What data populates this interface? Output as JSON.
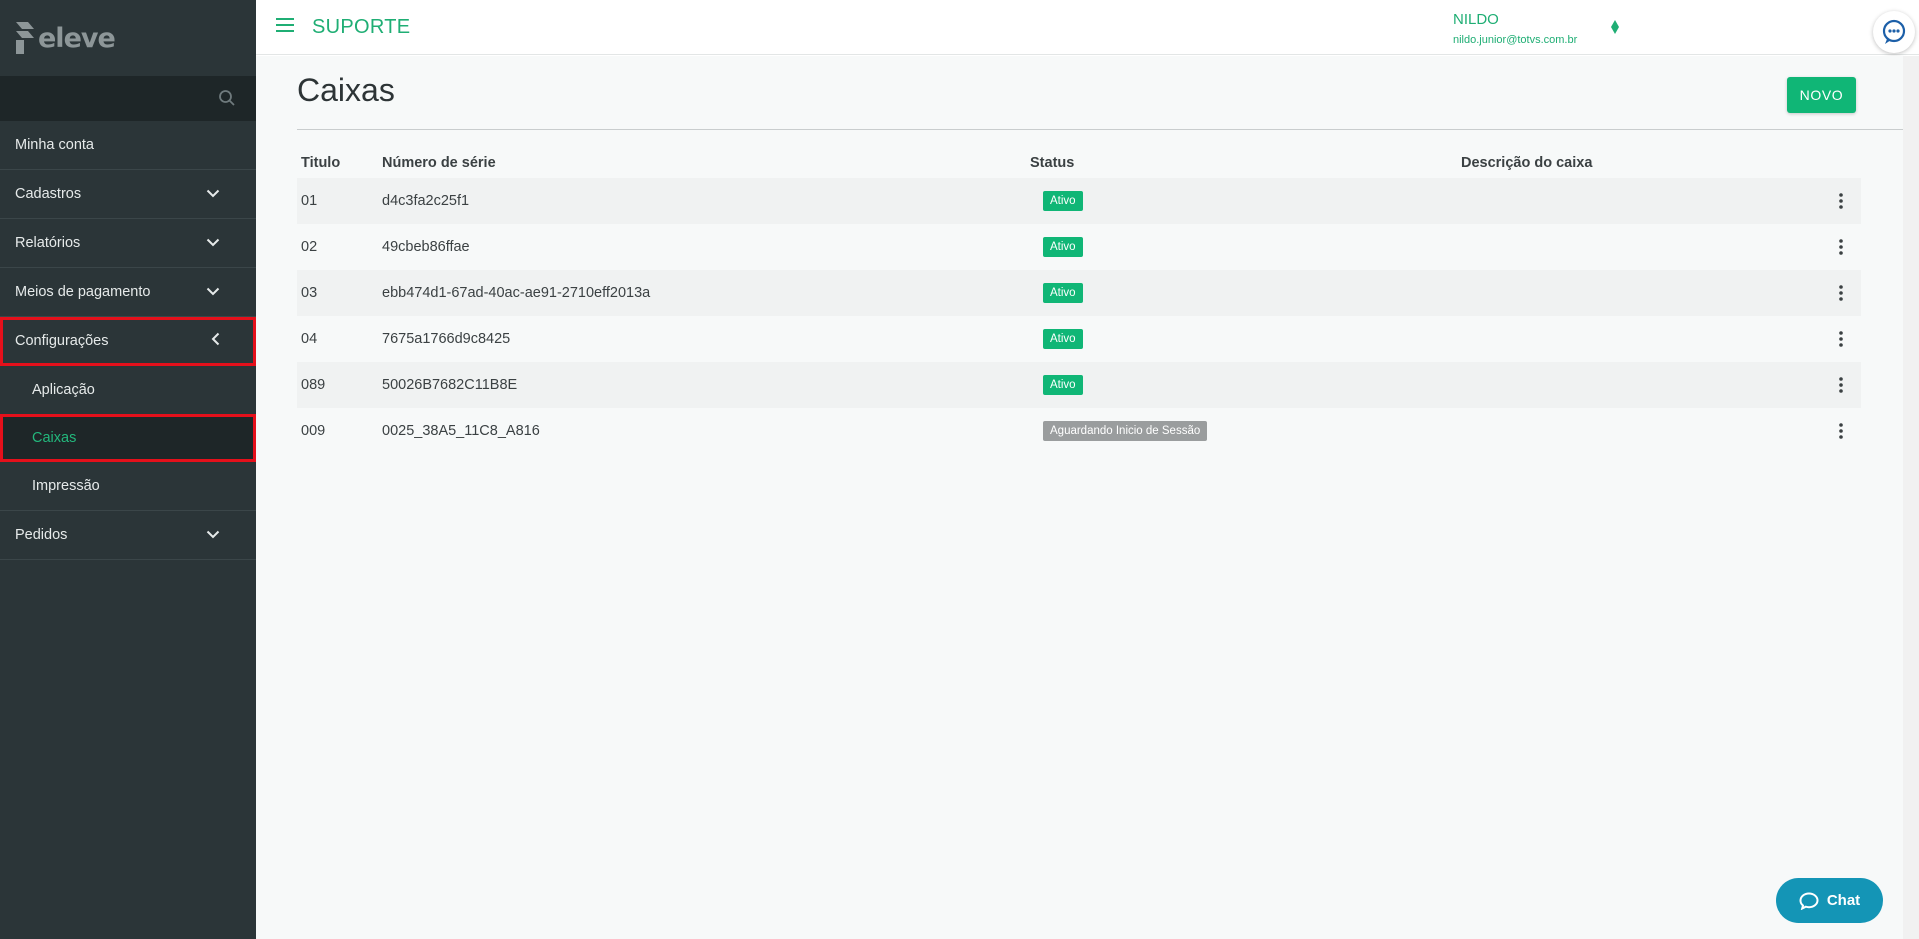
{
  "sidebar": {
    "logo_text": "eleve",
    "search_icon": "search-icon",
    "items": [
      {
        "label": "Minha conta",
        "icon": null
      },
      {
        "label": "Cadastros",
        "icon": "chevron-down-icon"
      },
      {
        "label": "Relatórios",
        "icon": "chevron-down-icon"
      },
      {
        "label": "Meios de pagamento",
        "icon": "chevron-down-icon"
      },
      {
        "label": "Configurações",
        "icon": "chevron-left-icon"
      }
    ],
    "config_subitems": [
      {
        "label": "Aplicação"
      },
      {
        "label": "Caixas"
      },
      {
        "label": "Impressão"
      }
    ],
    "pedidos_label": "Pedidos"
  },
  "header": {
    "app_title": "SUPORTE",
    "user_name": "NILDO",
    "user_email": "nildo.junior@totvs.com.br"
  },
  "page": {
    "title": "Caixas",
    "new_button_label": "NOVO"
  },
  "table": {
    "headers": {
      "titulo": "Titulo",
      "serie": "Número de série",
      "status": "Status",
      "descricao": "Descrição do caixa"
    },
    "rows": [
      {
        "titulo": "01",
        "serie": "d4c3fa2c25f1",
        "status": "Ativo",
        "descricao": ""
      },
      {
        "titulo": "02",
        "serie": "49cbeb86ffae",
        "status": "Ativo",
        "descricao": ""
      },
      {
        "titulo": "03",
        "serie": "ebb474d1-67ad-40ac-ae91-2710eff2013a",
        "status": "Ativo",
        "descricao": ""
      },
      {
        "titulo": "04",
        "serie": "7675a1766d9c8425",
        "status": "Ativo",
        "descricao": ""
      },
      {
        "titulo": "089",
        "serie": "50026B7682C11B8E",
        "status": "Ativo",
        "descricao": ""
      },
      {
        "titulo": "009",
        "serie": "0025_38A5_11C8_A816",
        "status": "Aguardando Inicio de Sessão",
        "descricao": ""
      }
    ]
  },
  "chat": {
    "label": "Chat"
  },
  "colors": {
    "accent": "#1fae74",
    "sidebar_bg": "#2b3538",
    "status_active": "#10b676",
    "status_waiting": "#9a9d9e",
    "highlight_outline": "#e5101b",
    "chat_bg": "#1495b6"
  }
}
